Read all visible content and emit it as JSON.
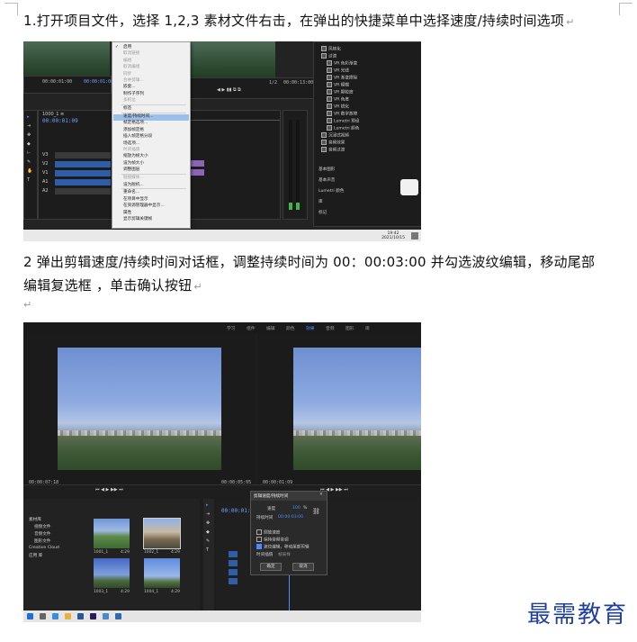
{
  "paragraph1": "1.打开项目文件，选择 1,2,3 素材文件右击，在弹出的快捷菜单中选择速度/持续时间选项",
  "paragraph2": "2 弹出剪辑速度/持续时间对话框，调整持续时间为 00：00:03:00 并勾选波纹编辑，移动尾部编辑复选框 ，单击确认按钮",
  "paragraph_mark": "↵",
  "watermark": "最需教育",
  "shot1": {
    "timecode_top_left": "00:00:01:00",
    "timecode_top_mid": "00:00:01:08",
    "timecode_program_left": "00:00:01:00",
    "timecode_program_right": "00:00:13:00",
    "fraction": "1/2",
    "sequence_tab": "1000_1 ≡",
    "timeline_timecode": "00:00:01:09",
    "context_menu": [
      {
        "label": "启用",
        "checked": true,
        "dim": false
      },
      {
        "label": "取消链接",
        "dim": true
      },
      {
        "label": "编组",
        "dim": true
      },
      {
        "label": "取消编组",
        "dim": true
      },
      {
        "label": "同步",
        "dim": true
      },
      {
        "label": "合并剪辑...",
        "dim": true
      },
      {
        "label": "嵌套...",
        "dim": false
      },
      {
        "label": "制作子序列",
        "dim": false
      },
      {
        "label": "多机位",
        "dim": true
      },
      {
        "label": "标签",
        "dim": false
      },
      {
        "label": "速度/持续时间...",
        "dim": false,
        "highlight": true
      },
      {
        "label": "帧定格选项...",
        "dim": false
      },
      {
        "label": "添加帧定格",
        "dim": false
      },
      {
        "label": "插入帧定格分段",
        "dim": false
      },
      {
        "label": "场选项...",
        "dim": false
      },
      {
        "label": "时间插值",
        "dim": true
      },
      {
        "label": "缩放为帧大小",
        "dim": false
      },
      {
        "label": "设为帧大小",
        "dim": false
      },
      {
        "label": "调整图层",
        "dim": false
      },
      {
        "label": "链接媒体...",
        "dim": true
      },
      {
        "label": "设为脱机...",
        "dim": false
      },
      {
        "label": "重命名...",
        "dim": false
      },
      {
        "label": "在项目中显示",
        "dim": false
      },
      {
        "label": "在资源管理器中显示...",
        "dim": false
      },
      {
        "label": "属性",
        "dim": false
      },
      {
        "label": "显示剪辑关键帧",
        "dim": false
      }
    ],
    "effects_list": [
      "风格化",
      "过渡",
      "VR 色彩渐变",
      "VR 光线",
      "VR 渐变擦除",
      "VR 模糊",
      "VR 颗粒度",
      "VR 色度",
      "VR 锐化",
      "VR 数字故障",
      "Lumetri 预设",
      "Lumetri 颜色",
      "沉浸式视频",
      "音频效果",
      "音频过渡"
    ],
    "effects_footer": [
      "基本图形",
      "基本声音",
      "Lumetri 颜色",
      "库",
      "标记"
    ],
    "clock_time": "19:42",
    "clock_date": "2021/10/15"
  },
  "shot2": {
    "workspace_tabs": [
      "学习",
      "组件",
      "编辑",
      "颜色",
      "效果",
      "音频",
      "图形",
      "库"
    ],
    "active_tab": "效果",
    "source_tc_left": "00:00:07:18",
    "source_tc_right": "00:00:05:05",
    "program_tc_left": "00:00:01:09",
    "timeline_tc": "00:00:01:09",
    "project_items": [
      "素材库",
      "视频文件",
      "音频文件",
      "图形文件",
      "Creative Cloud",
      "应用 库"
    ],
    "thumbs": [
      {
        "label": "1001_1",
        "dur": "4:29"
      },
      {
        "label": "1002_1",
        "dur": "4:29"
      },
      {
        "label": "1003_1",
        "dur": "4:29"
      },
      {
        "label": "1004_1",
        "dur": "4:29"
      }
    ],
    "dialog": {
      "title": "剪辑速度/持续时间",
      "speed_label": "速度",
      "speed_value": "100",
      "unit": "%",
      "duration_label": "持续时间",
      "duration_value": "00:00:03:00",
      "opt_reverse": "倒放速度",
      "opt_audio": "保持音频音调",
      "opt_ripple": "波纹编辑，移动尾部剪辑",
      "interp_label": "时间插值",
      "interp_value": "帧采样",
      "ok": "确定",
      "cancel": "取消"
    }
  }
}
